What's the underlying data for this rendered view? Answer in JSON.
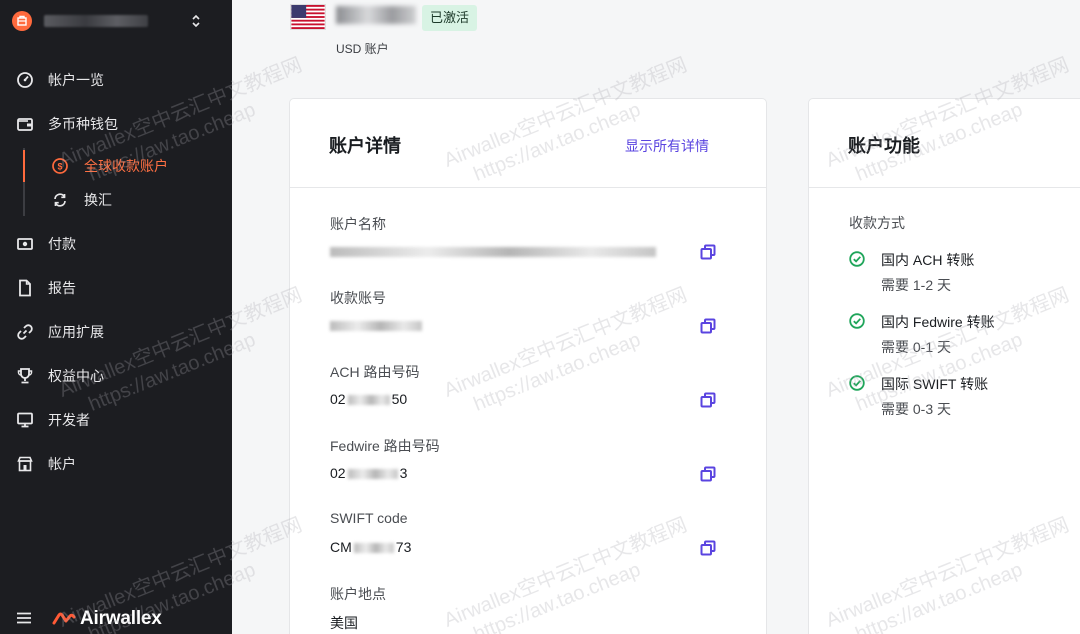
{
  "sidebar": {
    "nav": [
      {
        "key": "overview",
        "label": "帐户一览",
        "icon": "dashboard-icon"
      },
      {
        "key": "wallet",
        "label": "多币种钱包",
        "icon": "wallet-icon"
      },
      {
        "key": "payments",
        "label": "付款",
        "icon": "payment-icon"
      },
      {
        "key": "reports",
        "label": "报告",
        "icon": "report-icon"
      },
      {
        "key": "apps",
        "label": "应用扩展",
        "icon": "link-icon"
      },
      {
        "key": "rewards",
        "label": "权益中心",
        "icon": "trophy-icon"
      },
      {
        "key": "developer",
        "label": "开发者",
        "icon": "monitor-icon"
      },
      {
        "key": "account",
        "label": "帐户",
        "icon": "building-icon"
      }
    ],
    "wallet_sub": [
      {
        "label": "全球收款账户",
        "active": true,
        "icon": "dollar-circle-icon"
      },
      {
        "label": "换汇",
        "active": false,
        "icon": "exchange-icon"
      }
    ],
    "brand": "Airwallex"
  },
  "header": {
    "status_badge": "已激活",
    "currency_sub": "USD 账户"
  },
  "details_card": {
    "title": "账户详情",
    "show_all": "显示所有详情",
    "fields": [
      {
        "label": "账户名称",
        "value_prefix": "",
        "value_suffix": ""
      },
      {
        "label": "收款账号",
        "value_prefix": "",
        "value_suffix": ""
      },
      {
        "label": "ACH 路由号码",
        "value_prefix": "02",
        "value_suffix": "50"
      },
      {
        "label": "Fedwire 路由号码",
        "value_prefix": "02",
        "value_suffix": "3"
      },
      {
        "label": "SWIFT code",
        "value_prefix": "CM",
        "value_suffix": "73"
      },
      {
        "label": "账户地点",
        "value_prefix": "美国",
        "value_suffix": ""
      }
    ]
  },
  "features_card": {
    "title": "账户功能",
    "methods_label": "收款方式",
    "methods": [
      {
        "name": "国内 ACH 转账",
        "time": "需要 1-2 天"
      },
      {
        "name": "国内 Fedwire 转账",
        "time": "需要 0-1 天"
      },
      {
        "name": "国际 SWIFT 转账",
        "time": "需要 0-3 天"
      }
    ]
  },
  "watermark": {
    "line1": "Airwallex空中云汇中文教程网",
    "line2": "https://aw.tao.cheap"
  },
  "colors": {
    "sidebar_bg": "#1c1d21",
    "accent_orange": "#ff6a3d",
    "link_purple": "#5a44e0",
    "success_green": "#1fa55a",
    "badge_bg": "#d8f3e4"
  }
}
